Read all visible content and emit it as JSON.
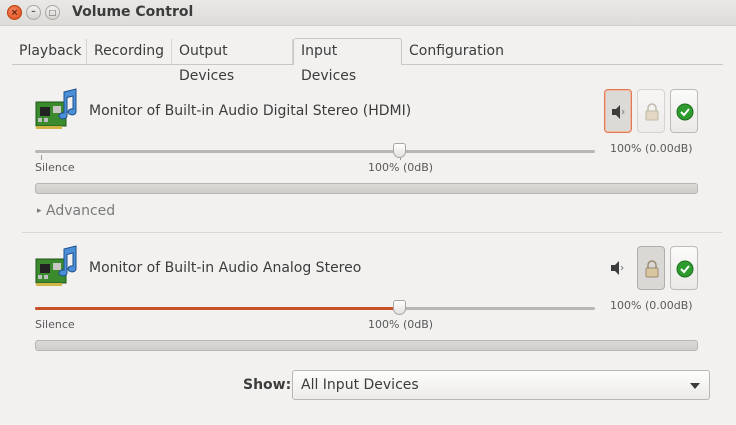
{
  "window": {
    "title": "Volume Control",
    "close_glyph": "×",
    "min_glyph": "–",
    "max_glyph": "□"
  },
  "tabs": [
    {
      "label": "Playback",
      "active": false
    },
    {
      "label": "Recording",
      "active": false
    },
    {
      "label": "Output Devices",
      "active": false
    },
    {
      "label": "Input Devices",
      "active": true
    },
    {
      "label": "Configuration",
      "active": false
    }
  ],
  "devices": [
    {
      "name": "Monitor of Built-in Audio Digital Stereo (HDMI)",
      "volume_percent": 100,
      "volume_label": "100% (0.00dB)",
      "silence_label": "Silence",
      "mark_label": "100% (0dB)",
      "mute_pressed": true,
      "lock_pressed": false,
      "default_on": true,
      "icon": "sound-card-icon",
      "advanced_label": "Advanced"
    },
    {
      "name": "Monitor of Built-in Audio Analog Stereo",
      "volume_percent": 100,
      "volume_label": "100% (0.00dB)",
      "silence_label": "Silence",
      "mark_label": "100% (0dB)",
      "mute_pressed": false,
      "lock_pressed": true,
      "default_on": true,
      "icon": "sound-card-icon"
    }
  ],
  "footer": {
    "show_label": "Show:",
    "show_value": "All Input Devices"
  },
  "colors": {
    "accent": "#c9512a",
    "check_green": "#2e9b2e"
  }
}
